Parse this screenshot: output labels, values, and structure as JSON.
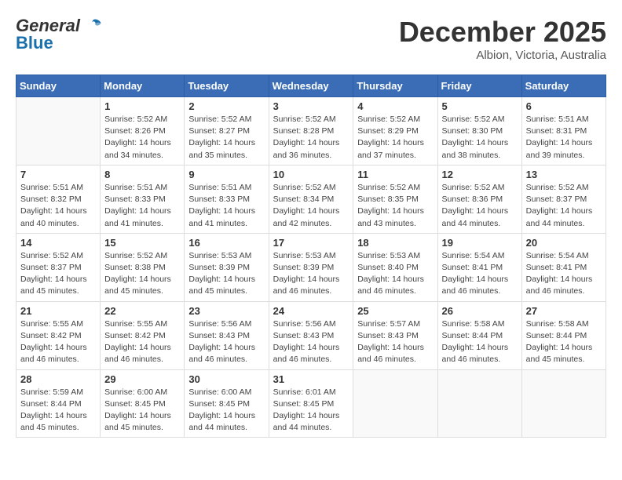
{
  "header": {
    "logo_general": "General",
    "logo_blue": "Blue",
    "month": "December 2025",
    "location": "Albion, Victoria, Australia"
  },
  "days_of_week": [
    "Sunday",
    "Monday",
    "Tuesday",
    "Wednesday",
    "Thursday",
    "Friday",
    "Saturday"
  ],
  "weeks": [
    [
      {
        "num": "",
        "sunrise": "",
        "sunset": "",
        "daylight": ""
      },
      {
        "num": "1",
        "sunrise": "Sunrise: 5:52 AM",
        "sunset": "Sunset: 8:26 PM",
        "daylight": "Daylight: 14 hours and 34 minutes."
      },
      {
        "num": "2",
        "sunrise": "Sunrise: 5:52 AM",
        "sunset": "Sunset: 8:27 PM",
        "daylight": "Daylight: 14 hours and 35 minutes."
      },
      {
        "num": "3",
        "sunrise": "Sunrise: 5:52 AM",
        "sunset": "Sunset: 8:28 PM",
        "daylight": "Daylight: 14 hours and 36 minutes."
      },
      {
        "num": "4",
        "sunrise": "Sunrise: 5:52 AM",
        "sunset": "Sunset: 8:29 PM",
        "daylight": "Daylight: 14 hours and 37 minutes."
      },
      {
        "num": "5",
        "sunrise": "Sunrise: 5:52 AM",
        "sunset": "Sunset: 8:30 PM",
        "daylight": "Daylight: 14 hours and 38 minutes."
      },
      {
        "num": "6",
        "sunrise": "Sunrise: 5:51 AM",
        "sunset": "Sunset: 8:31 PM",
        "daylight": "Daylight: 14 hours and 39 minutes."
      }
    ],
    [
      {
        "num": "7",
        "sunrise": "Sunrise: 5:51 AM",
        "sunset": "Sunset: 8:32 PM",
        "daylight": "Daylight: 14 hours and 40 minutes."
      },
      {
        "num": "8",
        "sunrise": "Sunrise: 5:51 AM",
        "sunset": "Sunset: 8:33 PM",
        "daylight": "Daylight: 14 hours and 41 minutes."
      },
      {
        "num": "9",
        "sunrise": "Sunrise: 5:51 AM",
        "sunset": "Sunset: 8:33 PM",
        "daylight": "Daylight: 14 hours and 41 minutes."
      },
      {
        "num": "10",
        "sunrise": "Sunrise: 5:52 AM",
        "sunset": "Sunset: 8:34 PM",
        "daylight": "Daylight: 14 hours and 42 minutes."
      },
      {
        "num": "11",
        "sunrise": "Sunrise: 5:52 AM",
        "sunset": "Sunset: 8:35 PM",
        "daylight": "Daylight: 14 hours and 43 minutes."
      },
      {
        "num": "12",
        "sunrise": "Sunrise: 5:52 AM",
        "sunset": "Sunset: 8:36 PM",
        "daylight": "Daylight: 14 hours and 44 minutes."
      },
      {
        "num": "13",
        "sunrise": "Sunrise: 5:52 AM",
        "sunset": "Sunset: 8:37 PM",
        "daylight": "Daylight: 14 hours and 44 minutes."
      }
    ],
    [
      {
        "num": "14",
        "sunrise": "Sunrise: 5:52 AM",
        "sunset": "Sunset: 8:37 PM",
        "daylight": "Daylight: 14 hours and 45 minutes."
      },
      {
        "num": "15",
        "sunrise": "Sunrise: 5:52 AM",
        "sunset": "Sunset: 8:38 PM",
        "daylight": "Daylight: 14 hours and 45 minutes."
      },
      {
        "num": "16",
        "sunrise": "Sunrise: 5:53 AM",
        "sunset": "Sunset: 8:39 PM",
        "daylight": "Daylight: 14 hours and 45 minutes."
      },
      {
        "num": "17",
        "sunrise": "Sunrise: 5:53 AM",
        "sunset": "Sunset: 8:39 PM",
        "daylight": "Daylight: 14 hours and 46 minutes."
      },
      {
        "num": "18",
        "sunrise": "Sunrise: 5:53 AM",
        "sunset": "Sunset: 8:40 PM",
        "daylight": "Daylight: 14 hours and 46 minutes."
      },
      {
        "num": "19",
        "sunrise": "Sunrise: 5:54 AM",
        "sunset": "Sunset: 8:41 PM",
        "daylight": "Daylight: 14 hours and 46 minutes."
      },
      {
        "num": "20",
        "sunrise": "Sunrise: 5:54 AM",
        "sunset": "Sunset: 8:41 PM",
        "daylight": "Daylight: 14 hours and 46 minutes."
      }
    ],
    [
      {
        "num": "21",
        "sunrise": "Sunrise: 5:55 AM",
        "sunset": "Sunset: 8:42 PM",
        "daylight": "Daylight: 14 hours and 46 minutes."
      },
      {
        "num": "22",
        "sunrise": "Sunrise: 5:55 AM",
        "sunset": "Sunset: 8:42 PM",
        "daylight": "Daylight: 14 hours and 46 minutes."
      },
      {
        "num": "23",
        "sunrise": "Sunrise: 5:56 AM",
        "sunset": "Sunset: 8:43 PM",
        "daylight": "Daylight: 14 hours and 46 minutes."
      },
      {
        "num": "24",
        "sunrise": "Sunrise: 5:56 AM",
        "sunset": "Sunset: 8:43 PM",
        "daylight": "Daylight: 14 hours and 46 minutes."
      },
      {
        "num": "25",
        "sunrise": "Sunrise: 5:57 AM",
        "sunset": "Sunset: 8:43 PM",
        "daylight": "Daylight: 14 hours and 46 minutes."
      },
      {
        "num": "26",
        "sunrise": "Sunrise: 5:58 AM",
        "sunset": "Sunset: 8:44 PM",
        "daylight": "Daylight: 14 hours and 46 minutes."
      },
      {
        "num": "27",
        "sunrise": "Sunrise: 5:58 AM",
        "sunset": "Sunset: 8:44 PM",
        "daylight": "Daylight: 14 hours and 45 minutes."
      }
    ],
    [
      {
        "num": "28",
        "sunrise": "Sunrise: 5:59 AM",
        "sunset": "Sunset: 8:44 PM",
        "daylight": "Daylight: 14 hours and 45 minutes."
      },
      {
        "num": "29",
        "sunrise": "Sunrise: 6:00 AM",
        "sunset": "Sunset: 8:45 PM",
        "daylight": "Daylight: 14 hours and 45 minutes."
      },
      {
        "num": "30",
        "sunrise": "Sunrise: 6:00 AM",
        "sunset": "Sunset: 8:45 PM",
        "daylight": "Daylight: 14 hours and 44 minutes."
      },
      {
        "num": "31",
        "sunrise": "Sunrise: 6:01 AM",
        "sunset": "Sunset: 8:45 PM",
        "daylight": "Daylight: 14 hours and 44 minutes."
      },
      {
        "num": "",
        "sunrise": "",
        "sunset": "",
        "daylight": ""
      },
      {
        "num": "",
        "sunrise": "",
        "sunset": "",
        "daylight": ""
      },
      {
        "num": "",
        "sunrise": "",
        "sunset": "",
        "daylight": ""
      }
    ]
  ]
}
